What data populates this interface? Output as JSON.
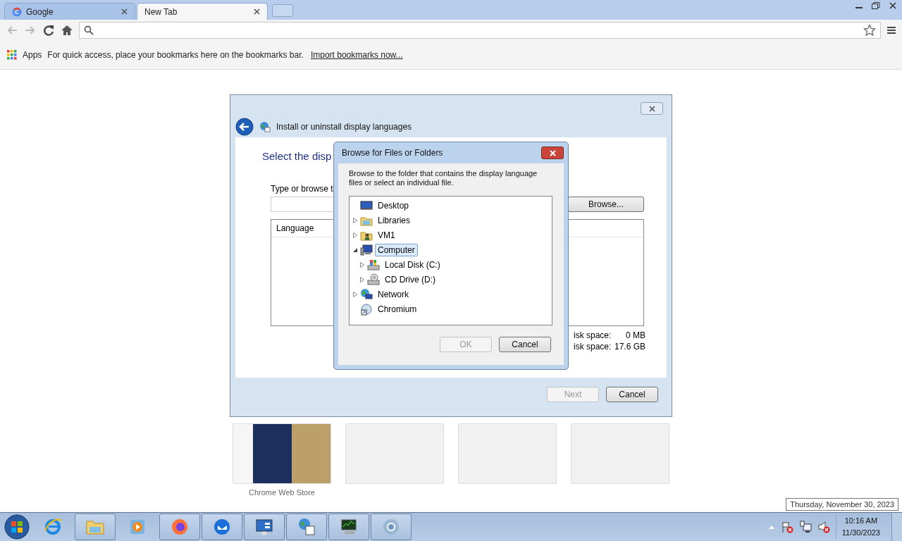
{
  "browser": {
    "tabs": [
      {
        "label": "Google",
        "selected": false
      },
      {
        "label": "New Tab",
        "selected": true
      }
    ],
    "bookmarks_bar": {
      "apps_label": "Apps",
      "message": "For quick access, place your bookmarks here on the bookmarks bar.",
      "link": "Import bookmarks now..."
    }
  },
  "new_tab": {
    "tiles": [
      {
        "kind": "thumbnail",
        "title": "Chrome Web Store"
      },
      {
        "kind": "empty"
      },
      {
        "kind": "empty"
      },
      {
        "kind": "empty"
      }
    ]
  },
  "language_wizard": {
    "title": "Install or uninstall display languages",
    "heading": "Select the disp",
    "field_label": "Type or browse t",
    "browse_button": "Browse...",
    "list_column": "Language",
    "stats": [
      {
        "label": "isk space:",
        "value": "0 MB"
      },
      {
        "label": "isk space:",
        "value": "17.6 GB"
      }
    ],
    "buttons": [
      {
        "label": "Next",
        "disabled": true
      },
      {
        "label": "Cancel",
        "disabled": false
      }
    ]
  },
  "browse_dialog": {
    "title": "Browse for Files or Folders",
    "instructions": "Browse to the folder that contains the display language files or select an individual file.",
    "tree": [
      {
        "label": "Desktop",
        "kind": "desktop",
        "selected": false,
        "children": [
          {
            "label": "Libraries",
            "kind": "library",
            "expanded": false,
            "selected": false
          },
          {
            "label": "VM1",
            "kind": "user-folder",
            "expanded": false,
            "selected": false
          },
          {
            "label": "Computer",
            "kind": "computer",
            "expanded": true,
            "selected": true,
            "children": [
              {
                "label": "Local Disk (C:)",
                "kind": "drive",
                "expanded": false,
                "selected": false
              },
              {
                "label": "CD Drive (D:)",
                "kind": "cd-drive",
                "expanded": false,
                "selected": false
              }
            ]
          },
          {
            "label": "Network",
            "kind": "network",
            "expanded": false,
            "selected": false
          },
          {
            "label": "Chromium",
            "kind": "shortcut",
            "selected": false
          }
        ]
      }
    ],
    "buttons": [
      {
        "label": "OK",
        "disabled": true
      },
      {
        "label": "Cancel",
        "disabled": false
      }
    ]
  },
  "taskbar": {
    "apps": [
      {
        "kind": "ie",
        "open": false
      },
      {
        "kind": "explorer",
        "open": true
      },
      {
        "kind": "media",
        "open": false
      },
      {
        "kind": "firefox",
        "open": true
      },
      {
        "kind": "thunderbird",
        "open": true
      },
      {
        "kind": "control",
        "open": true
      },
      {
        "kind": "network",
        "open": true
      },
      {
        "kind": "monitor",
        "open": true
      },
      {
        "kind": "chrome",
        "open": true
      }
    ],
    "clock_time": "10:16 AM",
    "clock_date": "11/30/2023",
    "tooltip": "Thursday, November 30, 2023"
  }
}
